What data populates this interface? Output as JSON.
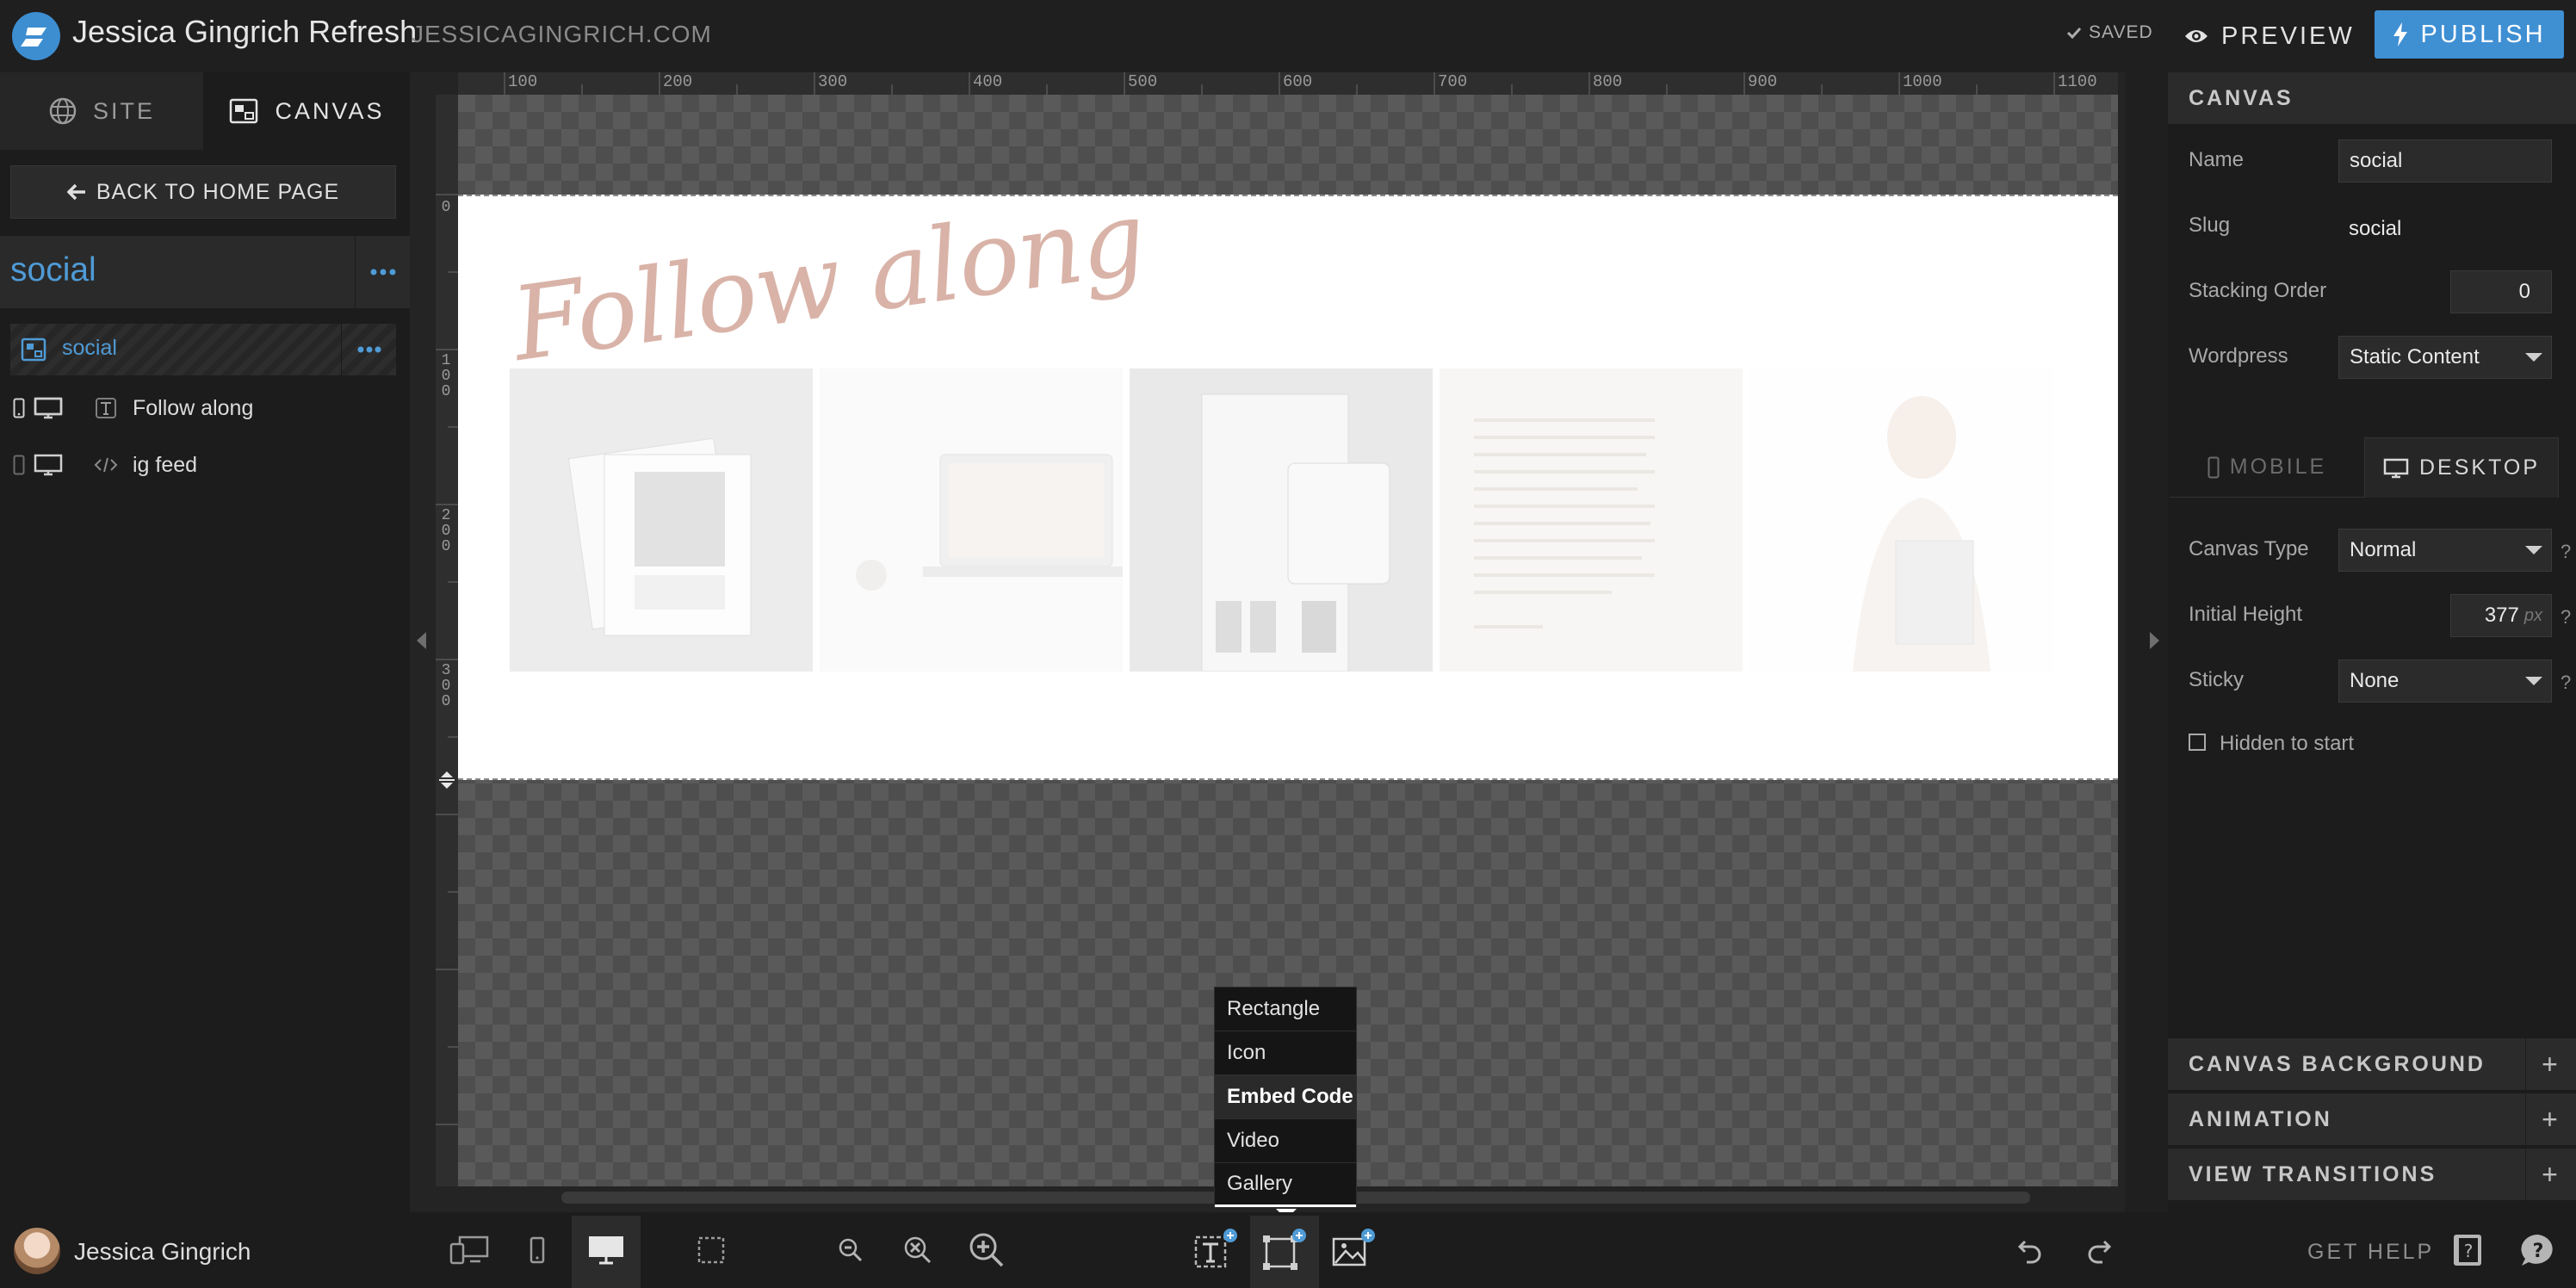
{
  "topbar": {
    "site_title": "Jessica Gingrich Refresh",
    "site_domain": "JESSICAGINGRICH.COM",
    "saved_label": "SAVED",
    "preview_label": "PREVIEW",
    "publish_label": "PUBLISH"
  },
  "left_panel": {
    "tabs": [
      {
        "label": "SITE"
      },
      {
        "label": "CANVAS"
      }
    ],
    "back_label": "BACK TO HOME PAGE",
    "page_name": "social",
    "layer_name": "social",
    "elements": [
      {
        "label": "Follow along",
        "type_icon": "text-icon"
      },
      {
        "label": "ig feed",
        "type_icon": "code-icon"
      }
    ]
  },
  "canvas": {
    "ruler_x": [
      "100",
      "200",
      "300",
      "400",
      "500",
      "600",
      "700",
      "800",
      "900",
      "1000",
      "1100"
    ],
    "ruler_y": [
      "0",
      "1\n0\n0",
      "2\n0\n0",
      "3\n0\n0"
    ],
    "heading_text": "Follow along"
  },
  "shape_menu": {
    "items": [
      "Rectangle",
      "Icon",
      "Embed Code",
      "Video",
      "Gallery"
    ],
    "highlighted": "Embed Code"
  },
  "right_panel": {
    "header": "CANVAS",
    "name_label": "Name",
    "name_value": "social",
    "slug_label": "Slug",
    "slug_value": "social",
    "stacking_label": "Stacking Order",
    "stacking_value": "0",
    "wordpress_label": "Wordpress",
    "wordpress_value": "Static Content",
    "device_tabs": [
      {
        "label": "MOBILE"
      },
      {
        "label": "DESKTOP"
      }
    ],
    "canvas_type_label": "Canvas Type",
    "canvas_type_value": "Normal",
    "initial_height_label": "Initial Height",
    "initial_height_value": "377",
    "initial_height_unit": "px",
    "sticky_label": "Sticky",
    "sticky_value": "None",
    "hidden_label": "Hidden to start",
    "help_mark": "?",
    "sections": [
      "CANVAS BACKGROUND",
      "ANIMATION",
      "VIEW TRANSITIONS"
    ]
  },
  "bottombar": {
    "user_name": "Jessica Gingrich",
    "help_label": "GET HELP"
  },
  "colors": {
    "accent": "#3f8fd3",
    "page_name": "#4f9bd6",
    "heading_script": "#d9b3a8"
  }
}
